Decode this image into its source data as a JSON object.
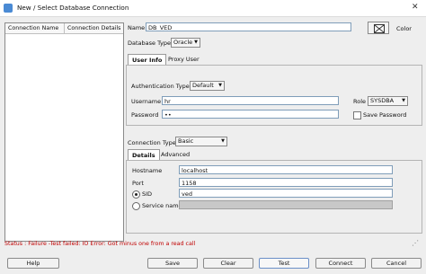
{
  "window": {
    "title": "New / Select Database Connection"
  },
  "list": {
    "columns": [
      "Connection Name",
      "Connection Details"
    ]
  },
  "form": {
    "name_label": "Name",
    "name_value": "DB_VED",
    "color_label": "Color",
    "dbtype_label": "Database Type",
    "dbtype_value": "Oracle",
    "tabs": [
      "User Info",
      "Proxy User"
    ],
    "auth_label": "Authentication Type",
    "auth_value": "Default",
    "username_label": "Username",
    "username_value": "hr",
    "role_label": "Role",
    "role_value": "SYSDBA",
    "password_label": "Password",
    "password_value": "••",
    "save_password_label": "Save Password",
    "conntype_label": "Connection Type",
    "conntype_value": "Basic",
    "subtabs": [
      "Details",
      "Advanced"
    ],
    "hostname_label": "Hostname",
    "hostname_value": "localhost",
    "port_label": "Port",
    "port_value": "1158",
    "sid_label": "SID",
    "sid_value": "ved",
    "service_label": "Service name",
    "service_value": ""
  },
  "status": "Status : Failure -Test failed: IO Error: Got minus one from a read call",
  "buttons": {
    "help": "Help",
    "save": "Save",
    "clear": "Clear",
    "test": "Test",
    "connect": "Connect",
    "cancel": "Cancel"
  }
}
